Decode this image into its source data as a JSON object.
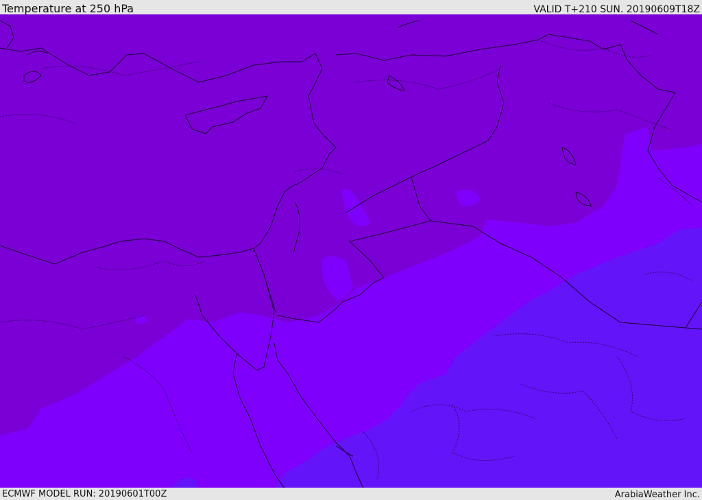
{
  "header": {
    "title": "Temperature at 250 hPa",
    "valid": "VALID T+210 SUN. 20190609T18Z"
  },
  "footer": {
    "model_run": "ECMWF MODEL RUN: 20190601T00Z",
    "credit": "ArabiaWeather Inc."
  },
  "colors": {
    "band_cold": "#7a00d6",
    "band_mid": "#7e00fc",
    "band_warm": "#6414f8",
    "coastline": "#1a0033",
    "border_dotted": "#2a0055"
  }
}
